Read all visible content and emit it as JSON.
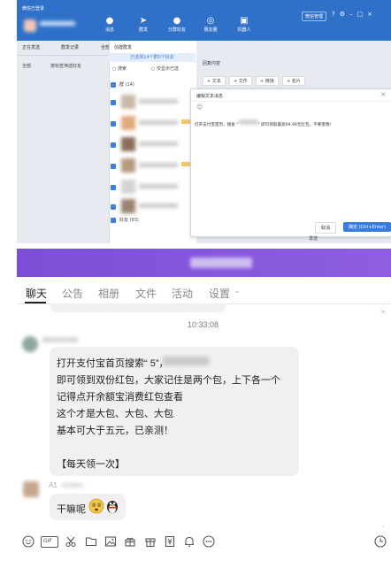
{
  "top": {
    "app_title": "微信已登录",
    "window_btn_label": "微信管理",
    "nav": [
      "消息",
      "群发",
      "分群好友",
      "朋友圈",
      "机器人"
    ],
    "tabs": [
      "正在发送",
      "群发记录",
      "全部"
    ],
    "filter_all": "全部",
    "filter_tag": "按标签筛选好友",
    "panel_title": "创建群发",
    "selected_banner": "已选择14个群0个好友",
    "search_label": "搜索",
    "only_selected": "仅显示已选",
    "group_header": "群 (14)",
    "friend_header": "好友 (93)",
    "reply_title": "回复内容",
    "reply_buttons": [
      "+ 文本",
      "+ 文件",
      "+ 链接",
      "+ 名片"
    ],
    "dialog": {
      "title": "编辑文本消息",
      "close": "×",
      "emoji": "☺",
      "text_before": "打开支付宝首页，搜索 \"",
      "text_after": "\" 即可领取最高99.99元红包，不要害我！",
      "cancel": "取消",
      "confirm": "确定 (Ctrl+Enter)"
    },
    "footer_send": "发送"
  },
  "chat": {
    "tabs": [
      "聊天",
      "公告",
      "相册",
      "文件",
      "活动",
      "设置"
    ],
    "active_tab": "聊天",
    "timestamp": "10:33:08",
    "message_lines": [
      "打开支付宝首页搜索“            5”，",
      "即可领到双份红包，大家记住是两个包，上下各一个",
      "记得点开余额宝消费红包查看",
      "这个才是大包、大包、大包",
      "基本可大于五元，已亲测！",
      "",
      "【每天领一次】"
    ],
    "reply_text": "干嘛呢",
    "reply_name_hint": "A1",
    "right_marker": "×",
    "toolbar_icons": [
      "smile-icon",
      "gif-icon",
      "scissors-icon",
      "folder-icon",
      "image-icon",
      "gift-box-icon",
      "present-icon",
      "voucher-icon",
      "bell-icon",
      "more-icon"
    ],
    "gif_label": "GIF"
  }
}
